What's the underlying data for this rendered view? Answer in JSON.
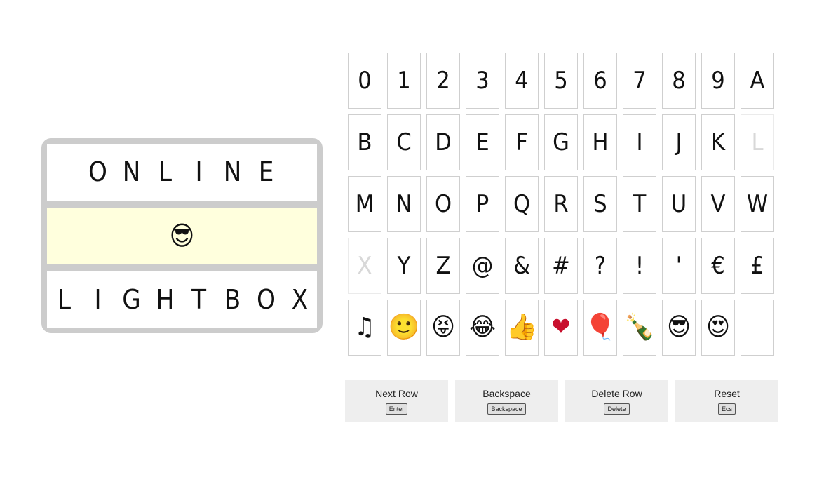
{
  "lightbox": {
    "rows": [
      {
        "chars": [
          "O",
          "N",
          "L",
          "I",
          "N",
          "E"
        ],
        "active": false
      },
      {
        "chars": [
          "😎"
        ],
        "active": true
      },
      {
        "chars": [
          "L",
          "I",
          "G",
          "H",
          "T",
          "B",
          "O",
          "X"
        ],
        "active": false
      }
    ]
  },
  "keys": [
    {
      "label": "0",
      "used": false
    },
    {
      "label": "1",
      "used": false
    },
    {
      "label": "2",
      "used": false
    },
    {
      "label": "3",
      "used": false
    },
    {
      "label": "4",
      "used": false
    },
    {
      "label": "5",
      "used": false
    },
    {
      "label": "6",
      "used": false
    },
    {
      "label": "7",
      "used": false
    },
    {
      "label": "8",
      "used": false
    },
    {
      "label": "9",
      "used": false
    },
    {
      "label": "A",
      "used": false
    },
    {
      "label": "B",
      "used": false
    },
    {
      "label": "C",
      "used": false
    },
    {
      "label": "D",
      "used": false
    },
    {
      "label": "E",
      "used": false
    },
    {
      "label": "F",
      "used": false
    },
    {
      "label": "G",
      "used": false
    },
    {
      "label": "H",
      "used": false
    },
    {
      "label": "I",
      "used": false
    },
    {
      "label": "J",
      "used": false
    },
    {
      "label": "K",
      "used": false
    },
    {
      "label": "L",
      "used": true
    },
    {
      "label": "M",
      "used": false
    },
    {
      "label": "N",
      "used": false
    },
    {
      "label": "O",
      "used": false
    },
    {
      "label": "P",
      "used": false
    },
    {
      "label": "Q",
      "used": false
    },
    {
      "label": "R",
      "used": false
    },
    {
      "label": "S",
      "used": false
    },
    {
      "label": "T",
      "used": false
    },
    {
      "label": "U",
      "used": false
    },
    {
      "label": "V",
      "used": false
    },
    {
      "label": "W",
      "used": false
    },
    {
      "label": "X",
      "used": true
    },
    {
      "label": "Y",
      "used": false
    },
    {
      "label": "Z",
      "used": false
    },
    {
      "label": "@",
      "used": false
    },
    {
      "label": "&",
      "used": false
    },
    {
      "label": "#",
      "used": false
    },
    {
      "label": "?",
      "used": false
    },
    {
      "label": "!",
      "used": false
    },
    {
      "label": "'",
      "used": false
    },
    {
      "label": "€",
      "used": false
    },
    {
      "label": "£",
      "used": false
    }
  ],
  "emoji_keys": [
    {
      "label": "♫",
      "icon": "music-note-icon"
    },
    {
      "label": "🙂",
      "icon": "slightly-smiling-face-icon"
    },
    {
      "label": "😝",
      "icon": "squinting-tongue-face-icon"
    },
    {
      "label": "😂",
      "icon": "tears-of-joy-face-icon"
    },
    {
      "label": "👍",
      "icon": "thumbs-up-icon"
    },
    {
      "label": "❤",
      "icon": "heart-icon"
    },
    {
      "label": "🎈",
      "icon": "balloon-icon"
    },
    {
      "label": "🍾",
      "icon": "champagne-bottle-icon"
    },
    {
      "label": "😎",
      "icon": "sunglasses-face-icon"
    },
    {
      "label": "😍",
      "icon": "heart-eyes-face-icon"
    },
    {
      "label": "",
      "icon": "blank-key"
    }
  ],
  "actions": [
    {
      "label": "Next Row",
      "key": "Enter"
    },
    {
      "label": "Backspace",
      "key": "Backspace"
    },
    {
      "label": "Delete Row",
      "key": "Delete"
    },
    {
      "label": "Reset",
      "key": "Ecs"
    }
  ],
  "colors": {
    "frame": "#cccccc",
    "active_row": "#ffffdd",
    "button_bg": "#eeeeee",
    "used_key_text": "#d8d8d8"
  }
}
